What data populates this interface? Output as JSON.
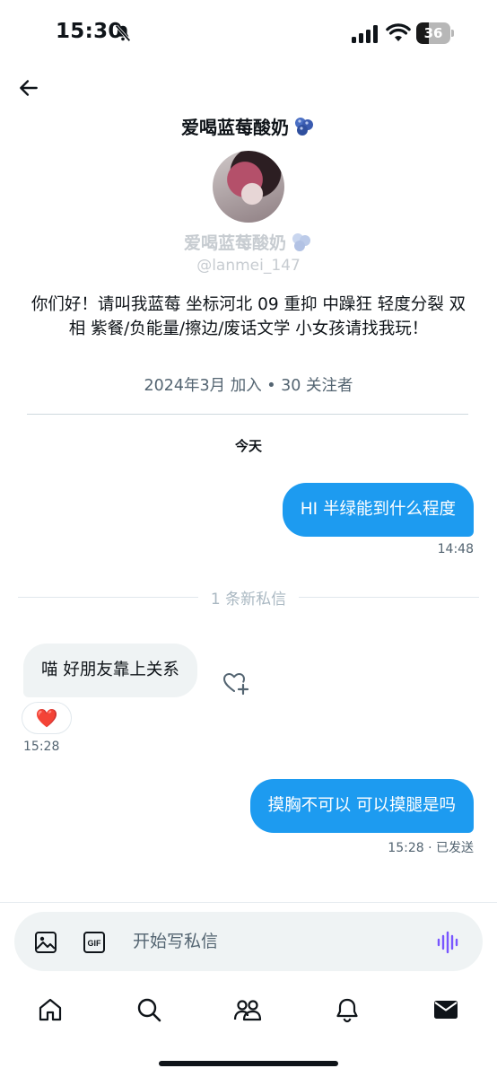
{
  "status_bar": {
    "time": "15:30",
    "battery": "36",
    "battery_level": 0.36
  },
  "header": {
    "title": "爱喝蓝莓酸奶"
  },
  "profile": {
    "name": "爱喝蓝莓酸奶",
    "handle": "@lanmei_147",
    "bio": "你们好！请叫我蓝莓 坐标河北 09 重抑 中躁狂 轻度分裂 双相 紫餐/负能量/擦边/废话文学 小女孩请找我玩！",
    "meta": "2024年3月 加入 • 30 关注者"
  },
  "conversation": {
    "date_label": "今天",
    "new_messages_label": "1 条新私信",
    "messages": [
      {
        "direction": "outgoing",
        "text": "HI 半绿能到什么程度",
        "time": "14:48"
      },
      {
        "direction": "incoming",
        "text": "喵 好朋友靠上关系",
        "reaction": "❤️",
        "time": "15:28"
      },
      {
        "direction": "outgoing",
        "text": "摸胸不可以 可以摸腿是吗",
        "time": "15:28 · 已发送"
      }
    ]
  },
  "composer": {
    "placeholder": "开始写私信"
  },
  "icons": {
    "back": "arrow-left-icon",
    "title_emoji": "blueberry-icon",
    "bell_off": "bell-off-icon",
    "image": "image-icon",
    "gif": "gif-icon",
    "voice": "voice-wave-icon",
    "tabs": [
      "home-icon",
      "search-icon",
      "communities-icon",
      "notifications-icon",
      "messages-icon"
    ]
  },
  "colors": {
    "accent": "#1d9bf0",
    "incoming_bubble": "#eff3f4",
    "secondary_text": "#536471",
    "voice": "#7856ff"
  }
}
